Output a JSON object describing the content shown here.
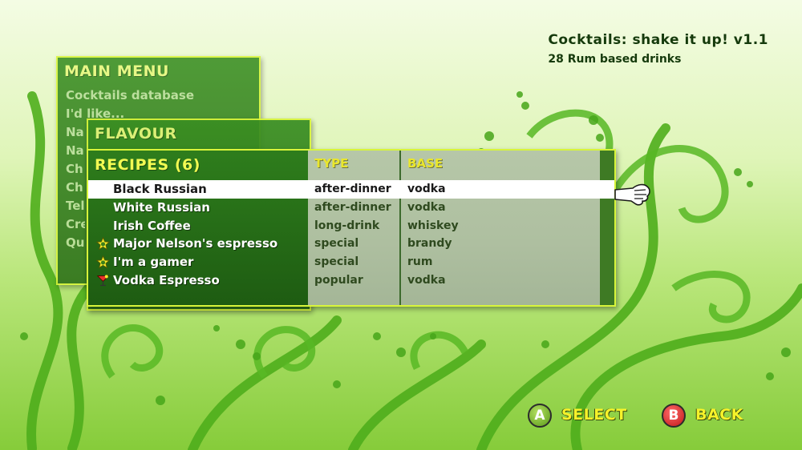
{
  "app": {
    "title": "Cocktails: shake  it up! v1.1",
    "subtitle": "28 Rum based drinks"
  },
  "main_menu": {
    "title": "MAIN MENU",
    "items": [
      {
        "label": "Cocktails database"
      },
      {
        "label": "I'd like..."
      },
      {
        "label": "Na"
      },
      {
        "label": "Na"
      },
      {
        "label": "Ch"
      },
      {
        "label": "Ch"
      },
      {
        "label": "Tel"
      },
      {
        "label": "Cre"
      },
      {
        "label": "Qui"
      }
    ]
  },
  "flavour_panel": {
    "title": "FLAVOUR"
  },
  "recipes": {
    "title": "RECIPES (6)",
    "columns": {
      "type": "TYPE",
      "base": "BASE"
    },
    "selected_index": 0,
    "rows": [
      {
        "name": "Black Russian",
        "type": "after-dinner",
        "base": "vodka",
        "icon": ""
      },
      {
        "name": "White Russian",
        "type": "after-dinner",
        "base": "vodka",
        "icon": ""
      },
      {
        "name": "Irish Coffee",
        "type": "long-drink",
        "base": "whiskey",
        "icon": ""
      },
      {
        "name": "Major Nelson's espresso",
        "type": "special",
        "base": "brandy",
        "icon": "star-badge-icon"
      },
      {
        "name": "I'm a gamer",
        "type": "special",
        "base": "rum",
        "icon": "star-badge-icon"
      },
      {
        "name": "Vodka Espresso",
        "type": "popular",
        "base": "vodka",
        "icon": "cocktail-glass-icon"
      }
    ]
  },
  "prompts": {
    "select": {
      "button": "A",
      "label": "SELECT"
    },
    "back": {
      "button": "B",
      "label": "BACK"
    }
  },
  "colors": {
    "panel_green": "#2a6e17",
    "title_yellow": "#f2fa52",
    "prompt_yellow": "#f6f22a",
    "button_a": "#5a9a18",
    "button_b": "#c01818"
  }
}
